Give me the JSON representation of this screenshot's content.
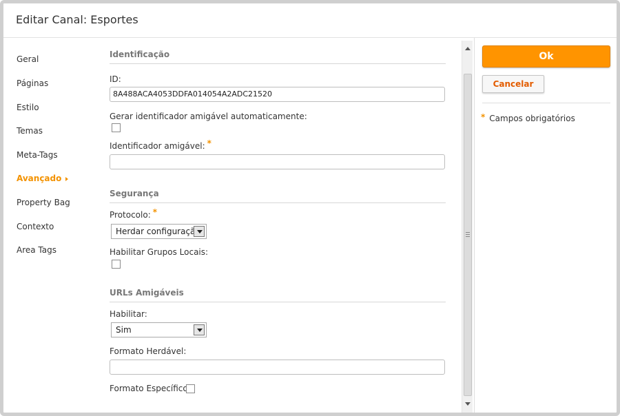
{
  "window": {
    "title": "Editar Canal: Esportes"
  },
  "nav": {
    "items": [
      {
        "label": "Geral"
      },
      {
        "label": "Páginas"
      },
      {
        "label": "Estilo"
      },
      {
        "label": "Temas"
      },
      {
        "label": "Meta-Tags"
      },
      {
        "label": "Avançado"
      },
      {
        "label": "Property Bag"
      },
      {
        "label": "Contexto"
      },
      {
        "label": "Area Tags"
      }
    ],
    "active_index": 5
  },
  "sections": {
    "identificacao": {
      "title": "Identificação",
      "id_label": "ID:",
      "id_value": "8A488ACA4053DDFA014054A2ADC21520",
      "auto_label": "Gerar identificador amigável automaticamente:",
      "auto_checked": false,
      "friendly_label": "Identificador amigável:",
      "friendly_value": ""
    },
    "seguranca": {
      "title": "Segurança",
      "protocol_label": "Protocolo:",
      "protocol_value": "Herdar configuração",
      "local_groups_label": "Habilitar Grupos Locais:",
      "local_groups_checked": false
    },
    "urls": {
      "title": "URLs Amigáveis",
      "enable_label": "Habilitar:",
      "enable_value": "Sim",
      "inherited_label": "Formato Herdável:",
      "inherited_value": "",
      "specific_label": "Formato Específico:",
      "specific_checked": false
    }
  },
  "actions": {
    "ok_label": "Ok",
    "cancel_label": "Cancelar"
  },
  "legend": {
    "required_marker": "*",
    "required_text": "Campos obrigatórios"
  },
  "colors": {
    "accent": "#f39200",
    "ok_button": "#ff9400",
    "cancel_text": "#e35c00"
  }
}
